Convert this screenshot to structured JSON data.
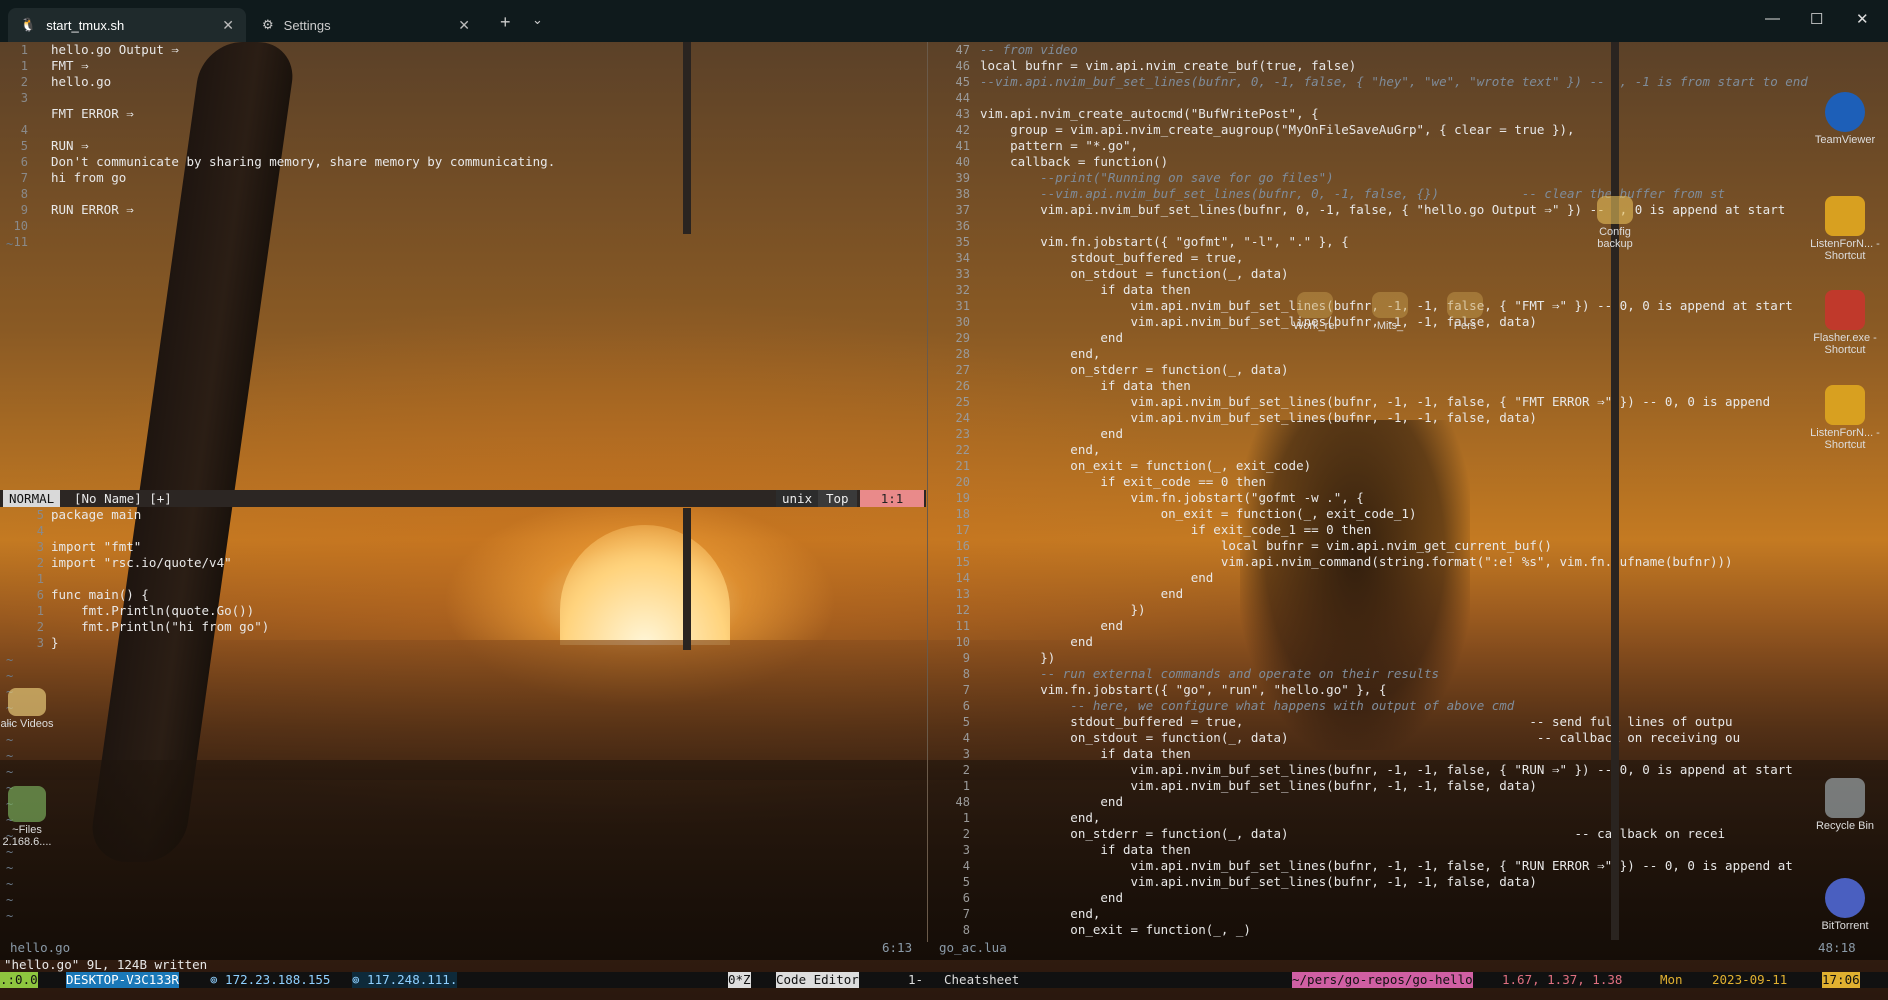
{
  "titlebar": {
    "tabs": [
      {
        "label": "start_tmux.sh",
        "icon": "linux-tux-icon"
      },
      {
        "label": "Settings",
        "icon": "gear-icon"
      }
    ],
    "new_tab": "+",
    "dropdown": "⌄",
    "minimize": "—",
    "maximize": "☐",
    "close": "✕"
  },
  "left_top": {
    "gutter": [
      "1",
      "1",
      "2",
      "3",
      "",
      "4",
      "5",
      "6",
      "7",
      "8",
      "9",
      "10",
      "11"
    ],
    "lines": [
      "hello.go Output ⇒",
      "FMT ⇒",
      "hello.go",
      "",
      "FMT ERROR ⇒",
      "",
      "RUN ⇒",
      "Don't communicate by sharing memory, share memory by communicating.",
      "hi from go",
      "",
      "RUN ERROR ⇒",
      ""
    ]
  },
  "status_top": {
    "mode": "NORMAL",
    "file": "[No Name] [+]",
    "fileformat": "unix",
    "scroll": "Top",
    "position": "1:1"
  },
  "left_bottom": {
    "gutter": [
      "5",
      "4",
      "3",
      "2",
      "1",
      "6",
      "1",
      "2",
      "3"
    ],
    "lines": [
      "package main",
      "",
      "import \"fmt\"",
      "import \"rsc.io/quote/v4\"",
      "",
      "func main() {",
      "    fmt.Println(quote.Go())",
      "    fmt.Println(\"hi from go\")",
      "}"
    ]
  },
  "right": {
    "gutter": [
      "47",
      "46",
      "45",
      "44",
      "43",
      "42",
      "41",
      "40",
      "39",
      "38",
      "37",
      "36",
      "35",
      "34",
      "33",
      "32",
      "31",
      "30",
      "29",
      "28",
      "27",
      "26",
      "25",
      "24",
      "23",
      "22",
      "21",
      "20",
      "19",
      "18",
      "17",
      "16",
      "15",
      "14",
      "13",
      "12",
      "11",
      "10",
      "9",
      "8",
      "7",
      "6",
      "5",
      "4",
      "3",
      "2",
      "1",
      "48",
      "1",
      "2",
      "3",
      "4",
      "5",
      "6",
      "7",
      "8"
    ],
    "lines": [
      "-- from video",
      "local bufnr = vim.api.nvim_create_buf(true, false)",
      "--vim.api.nvim_buf_set_lines(bufnr, 0, -1, false, { \"hey\", \"we\", \"wrote text\" }) -- 0, -1 is from start to end",
      "",
      "vim.api.nvim_create_autocmd(\"BufWritePost\", {",
      "    group = vim.api.nvim_create_augroup(\"MyOnFileSaveAuGrp\", { clear = true }),",
      "    pattern = \"*.go\",",
      "    callback = function()",
      "        --print(\"Running on save for go files\")",
      "        --vim.api.nvim_buf_set_lines(bufnr, 0, -1, false, {})           -- clear the buffer from st",
      "        vim.api.nvim_buf_set_lines(bufnr, 0, -1, false, { \"hello.go Output ⇒\" }) -- 0, 0 is append at start",
      "",
      "        vim.fn.jobstart({ \"gofmt\", \"-l\", \".\" }, {",
      "            stdout_buffered = true,",
      "            on_stdout = function(_, data)",
      "                if data then",
      "                    vim.api.nvim_buf_set_lines(bufnr, -1, -1, false, { \"FMT ⇒\" }) -- 0, 0 is append at start",
      "                    vim.api.nvim_buf_set_lines(bufnr, -1, -1, false, data)",
      "                end",
      "            end,",
      "            on_stderr = function(_, data)",
      "                if data then",
      "                    vim.api.nvim_buf_set_lines(bufnr, -1, -1, false, { \"FMT ERROR ⇒\" }) -- 0, 0 is append",
      "                    vim.api.nvim_buf_set_lines(bufnr, -1, -1, false, data)",
      "                end",
      "            end,",
      "            on_exit = function(_, exit_code)",
      "                if exit_code == 0 then",
      "                    vim.fn.jobstart(\"gofmt -w .\", {",
      "                        on_exit = function(_, exit_code_1)",
      "                            if exit_code_1 == 0 then",
      "                                local bufnr = vim.api.nvim_get_current_buf()",
      "                                vim.api.nvim_command(string.format(\":e! %s\", vim.fn.bufname(bufnr)))",
      "                            end",
      "                        end",
      "                    })",
      "                end",
      "            end",
      "        })",
      "        -- run external commands and operate on their results",
      "        vim.fn.jobstart({ \"go\", \"run\", \"hello.go\" }, {",
      "            -- here, we configure what happens with output of above cmd",
      "            stdout_buffered = true,                                      -- send full lines of outpu",
      "            on_stdout = function(_, data)                                 -- callback on receiving ou",
      "                if data then",
      "                    vim.api.nvim_buf_set_lines(bufnr, -1, -1, false, { \"RUN ⇒\" }) -- 0, 0 is append at start",
      "                    vim.api.nvim_buf_set_lines(bufnr, -1, -1, false, data)",
      "                end",
      "            end,",
      "            on_stderr = function(_, data)                                      -- callback on recei",
      "                if data then",
      "                    vim.api.nvim_buf_set_lines(bufnr, -1, -1, false, { \"RUN ERROR ⇒\" }) -- 0, 0 is append at",
      "                    vim.api.nvim_buf_set_lines(bufnr, -1, -1, false, data)",
      "                end",
      "            end,",
      "            on_exit = function(_, _)"
    ]
  },
  "bottom": {
    "left_file": "hello.go",
    "left_pos": "6:13",
    "right_file": "go_ac.lua",
    "right_pos": "48:18",
    "message": "\"hello.go\" 9L, 124B written"
  },
  "tmux": {
    "session": " .:0.0 ",
    "host": " DESKTOP-V3C133R ",
    "ip1": " ⊚ 172.23.188.155 ",
    "ip2": " ⊚ 117.248.111. ",
    "win0": " 0*Z ",
    "win0_name": " Code Editor ",
    "win1": " 1- ",
    "win1_name": " Cheatsheet ",
    "path": " ~/pers/go-repos/go-hello ",
    "load": " 1.67, 1.37, 1.38 ",
    "day": " Mon ",
    "date": " 2023-09-11 ",
    "time": " 17:06 ",
    "colors": {
      "green": "#8ec63f",
      "blue": "#1a78b8",
      "pink": "#d05fa3",
      "yellow": "#e0b030"
    }
  },
  "desktop_icons": [
    {
      "label": "TeamViewer"
    },
    {
      "label": "Config backup"
    },
    {
      "label": "ListenForN... - Shortcut"
    },
    {
      "label": "Work_rel"
    },
    {
      "label": "Mits_"
    },
    {
      "label": "Pers"
    },
    {
      "label": "Flasher.exe - Shortcut"
    },
    {
      "label": "ListenForN... - Shortcut"
    },
    {
      "label": "alic Videos"
    },
    {
      "label": "~Files 2.168.6...."
    },
    {
      "label": "Recycle Bin"
    },
    {
      "label": "BitTorrent"
    }
  ]
}
